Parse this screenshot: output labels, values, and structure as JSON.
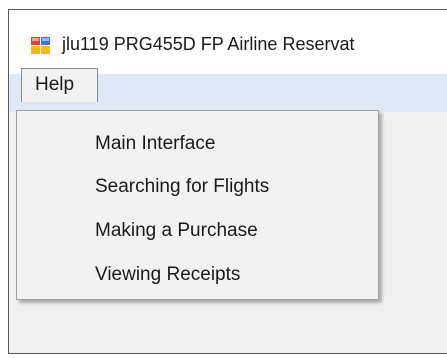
{
  "window": {
    "title": "jlu119 PRG455D FP Airline Reservat",
    "icon": "app-window-icon"
  },
  "menubar": {
    "help_label": "Help"
  },
  "help_menu": {
    "items": [
      {
        "label": "Main Interface"
      },
      {
        "label": "Searching for Flights"
      },
      {
        "label": "Making a Purchase"
      },
      {
        "label": "Viewing Receipts"
      }
    ]
  },
  "colors": {
    "menubar_bg": "#dfe9f5",
    "menu_bg": "#f2f2f2",
    "window_bg": "#f0f0f0"
  }
}
